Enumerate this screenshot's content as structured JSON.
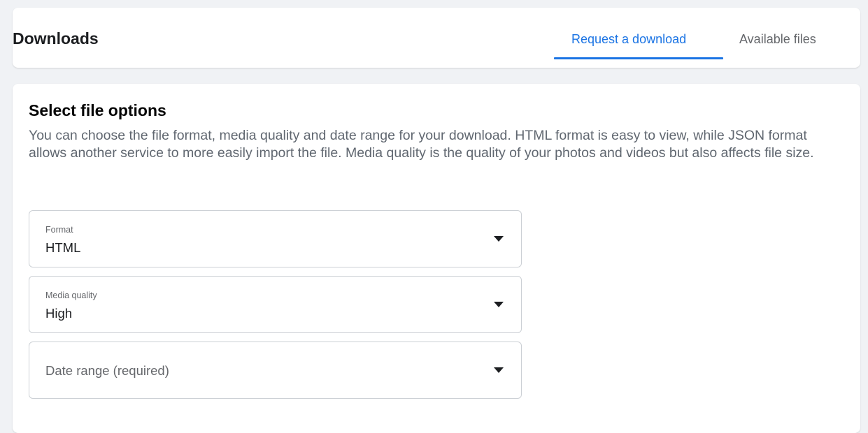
{
  "header": {
    "title": "Downloads",
    "tabs": [
      {
        "label": "Request a download",
        "active": true
      },
      {
        "label": "Available files",
        "active": false
      }
    ]
  },
  "section": {
    "title": "Select file options",
    "description": "You can choose the file format, media quality and date range for your download. HTML format is easy to view, while JSON format allows another service to more easily import the file. Media quality is the quality of your photos and videos but also affects file size."
  },
  "fields": {
    "format": {
      "label": "Format",
      "value": "HTML"
    },
    "media_quality": {
      "label": "Media quality",
      "value": "High"
    },
    "date_range": {
      "placeholder": "Date range (required)"
    }
  },
  "icons": {
    "dropdown": "caret-down-icon"
  },
  "colors": {
    "accent": "#1b74e4",
    "background": "#f0f2f5",
    "text": "#1c1e21",
    "muted": "#65676b"
  }
}
